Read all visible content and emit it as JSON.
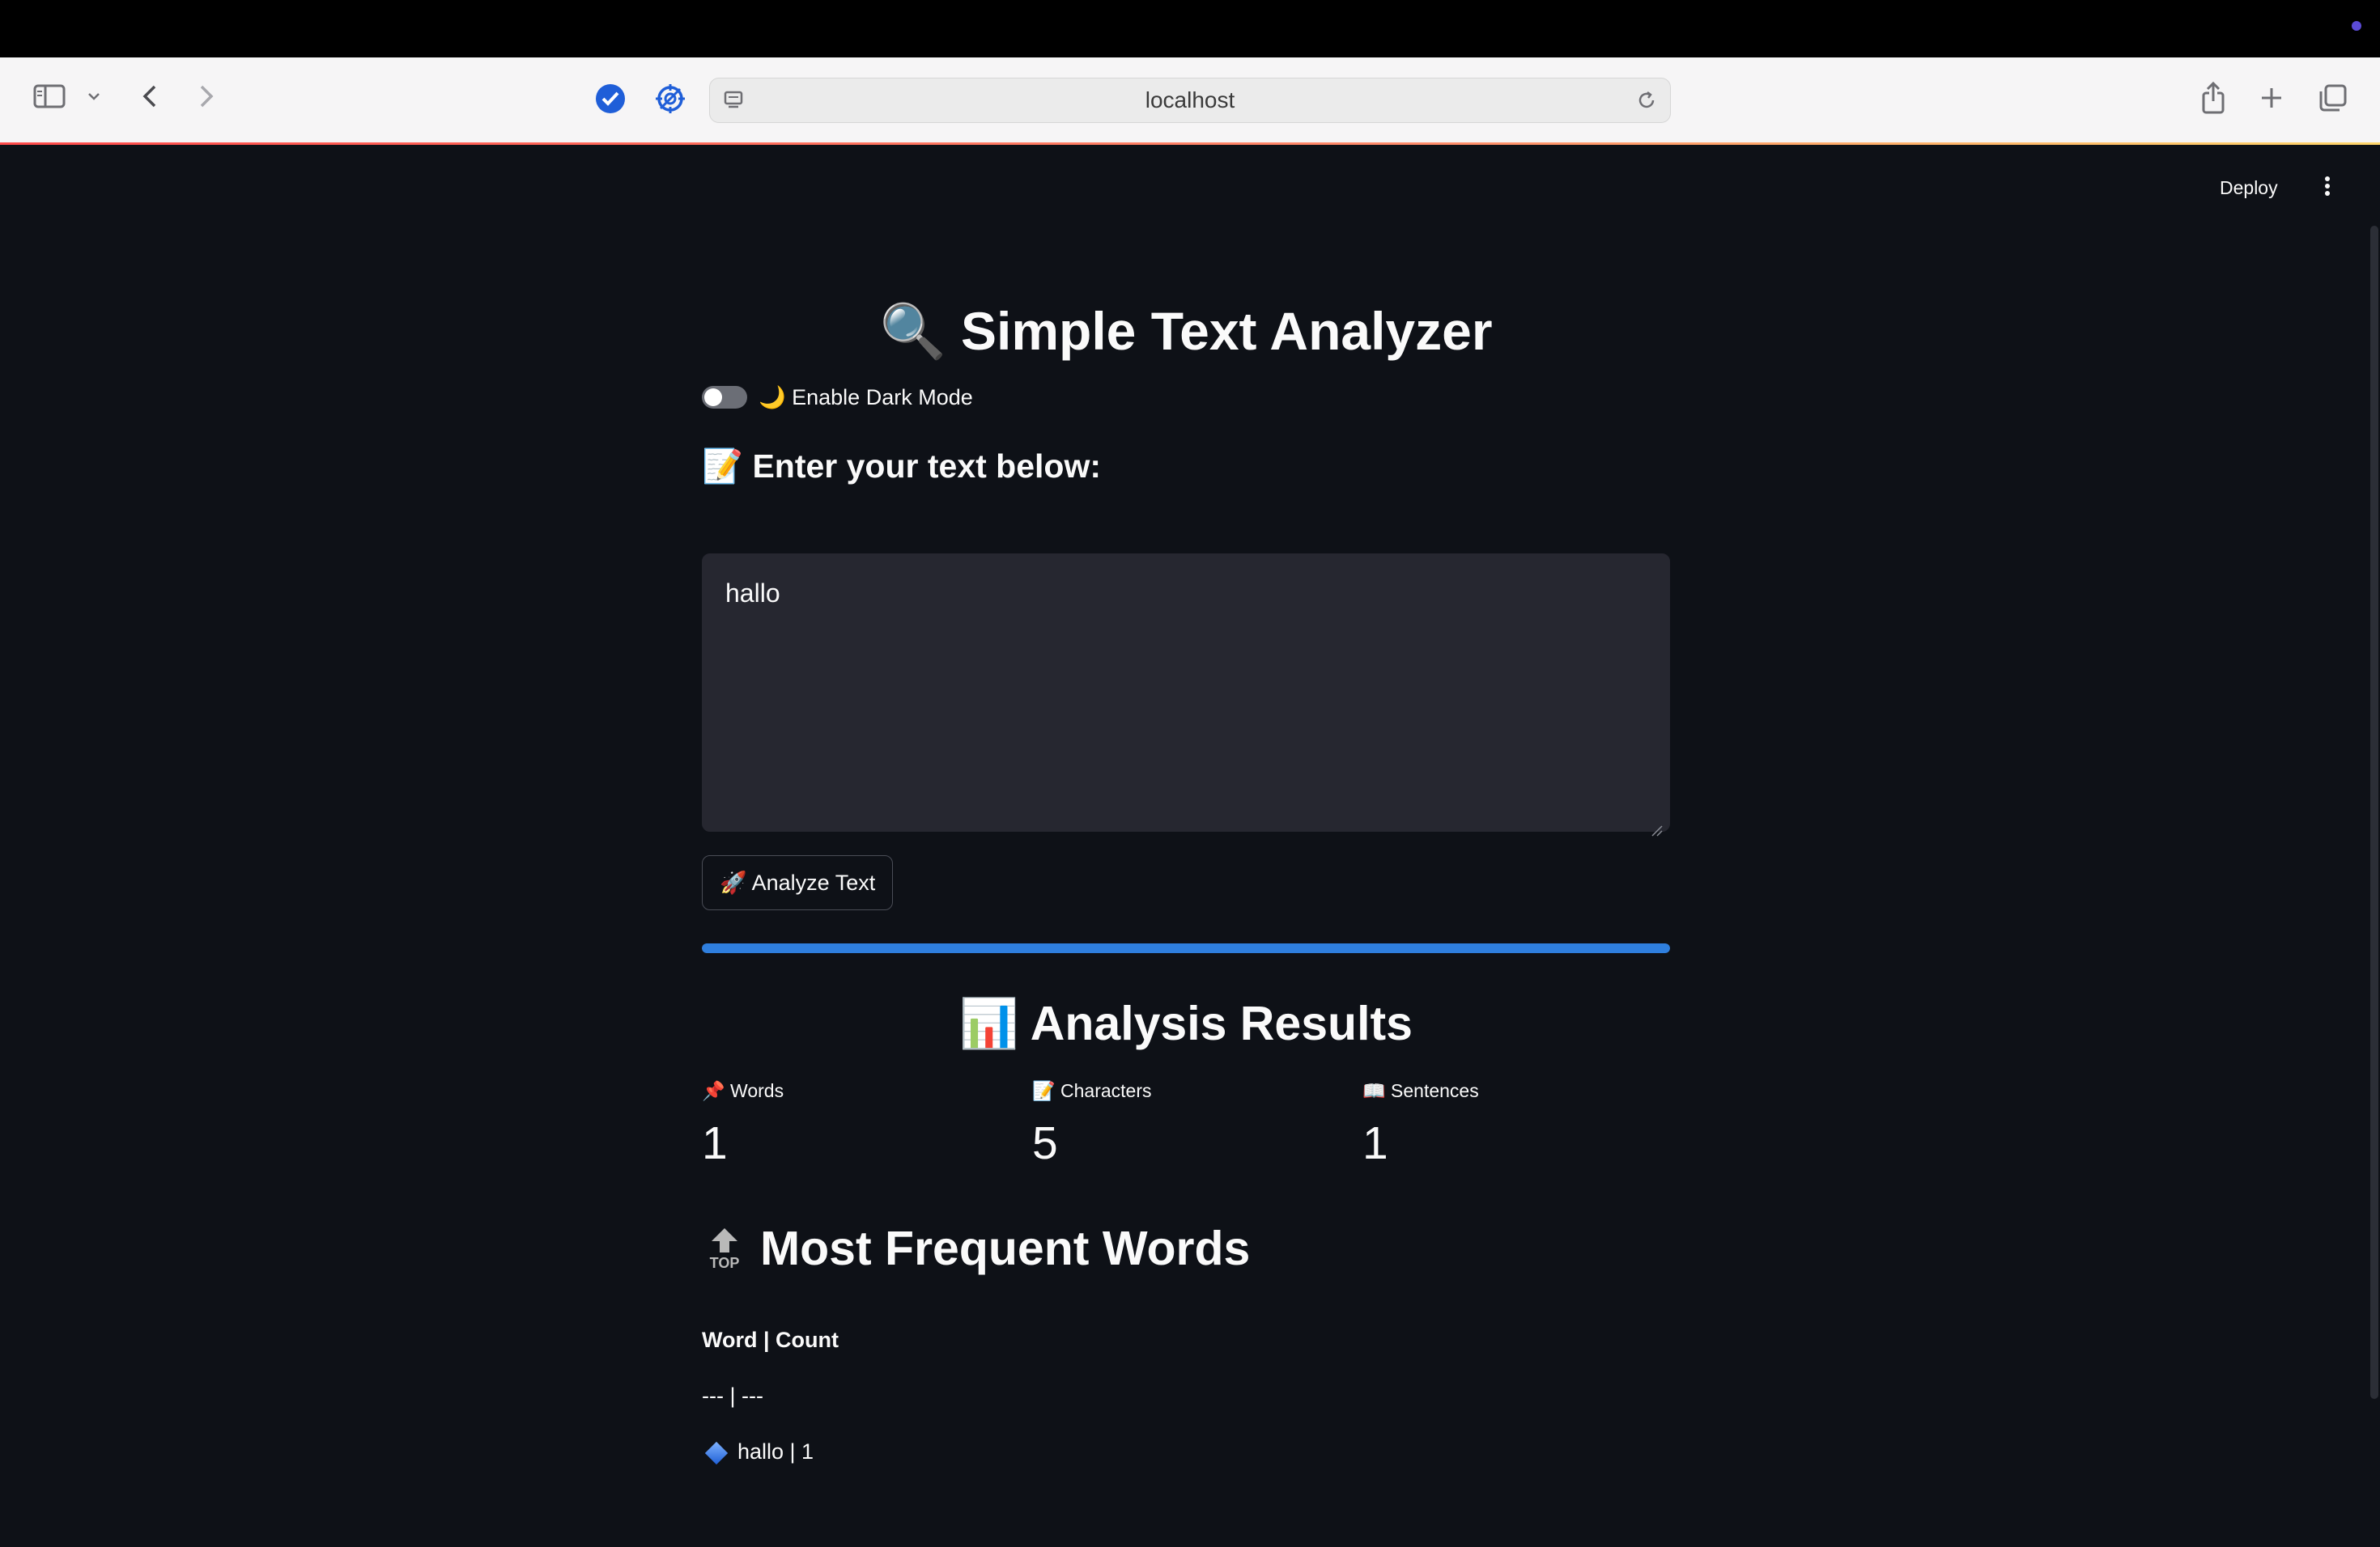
{
  "browser": {
    "url": "localhost"
  },
  "header": {
    "deploy_label": "Deploy"
  },
  "app": {
    "title": "🔍 Simple Text Analyzer",
    "dark_mode_toggle": {
      "label": "🌙 Enable Dark Mode",
      "checked": false
    },
    "input_header": "📝 Enter your text below:",
    "text_input_value": "hallo",
    "analyze_button_label": "🚀 Analyze Text",
    "progress": 1.0,
    "results_title": "📊 Analysis Results",
    "metrics": [
      {
        "label": "📌 Words",
        "value": "1"
      },
      {
        "label": "📝 Characters",
        "value": "5"
      },
      {
        "label": "📖 Sentences",
        "value": "1"
      }
    ],
    "frequent_words_title": "Most Frequent Words",
    "frequent_words_icon_text": "TOP",
    "table_header": "Word | Count",
    "table_separator": "--- | ---",
    "table_row": "hallo | 1"
  },
  "colors": {
    "app_background": "#0e1117",
    "input_background": "#262730",
    "progress_fill": "#2f7fde",
    "toolbar_background": "#f6f5f6"
  },
  "icons": {
    "sidebar": "sidebar-icon",
    "back": "chevron-left-icon",
    "forward": "chevron-right-icon",
    "share": "share-icon",
    "new_tab": "plus-icon",
    "tabs": "tab-overview-icon"
  }
}
